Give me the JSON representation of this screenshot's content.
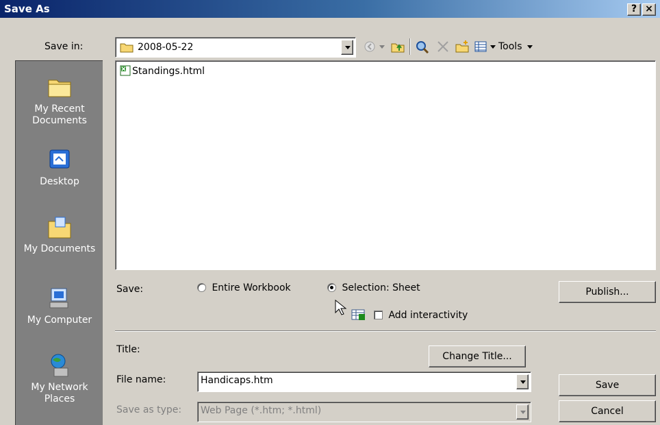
{
  "window": {
    "title": "Save As",
    "help_label": "?",
    "close_label": "×"
  },
  "toolbar": {
    "save_in_label": "Save in:",
    "save_in_value": "2008-05-22",
    "tools_label": "Tools"
  },
  "places": [
    {
      "label": "My Recent\nDocuments",
      "icon": "recent-documents-folder-icon"
    },
    {
      "label": "Desktop",
      "icon": "desktop-icon"
    },
    {
      "label": "My Documents",
      "icon": "my-documents-folder-icon"
    },
    {
      "label": "My Computer",
      "icon": "computer-icon"
    },
    {
      "label": "My Network\nPlaces",
      "icon": "network-places-icon"
    }
  ],
  "files": [
    {
      "name": "Standings.html",
      "icon": "excel-html-file-icon"
    }
  ],
  "save_options": {
    "label": "Save:",
    "entire_workbook": "Entire Workbook",
    "selection_sheet": "Selection: Sheet",
    "selected": "Selection: Sheet",
    "add_interactivity": "Add interactivity",
    "publish_button": "Publish..."
  },
  "form": {
    "title_label": "Title:",
    "change_title_button": "Change Title...",
    "file_name_label": "File name:",
    "file_name_value": "Handicaps.htm",
    "save_as_type_label": "Save as type:",
    "save_as_type_value": "Web Page (*.htm; *.html)",
    "save_button": "Save",
    "cancel_button": "Cancel"
  },
  "colors": {
    "title_bar_start": "#0a246a",
    "title_bar_end": "#a6caf0",
    "dialog_face": "#d4d0c8",
    "places_bar": "#808080"
  }
}
